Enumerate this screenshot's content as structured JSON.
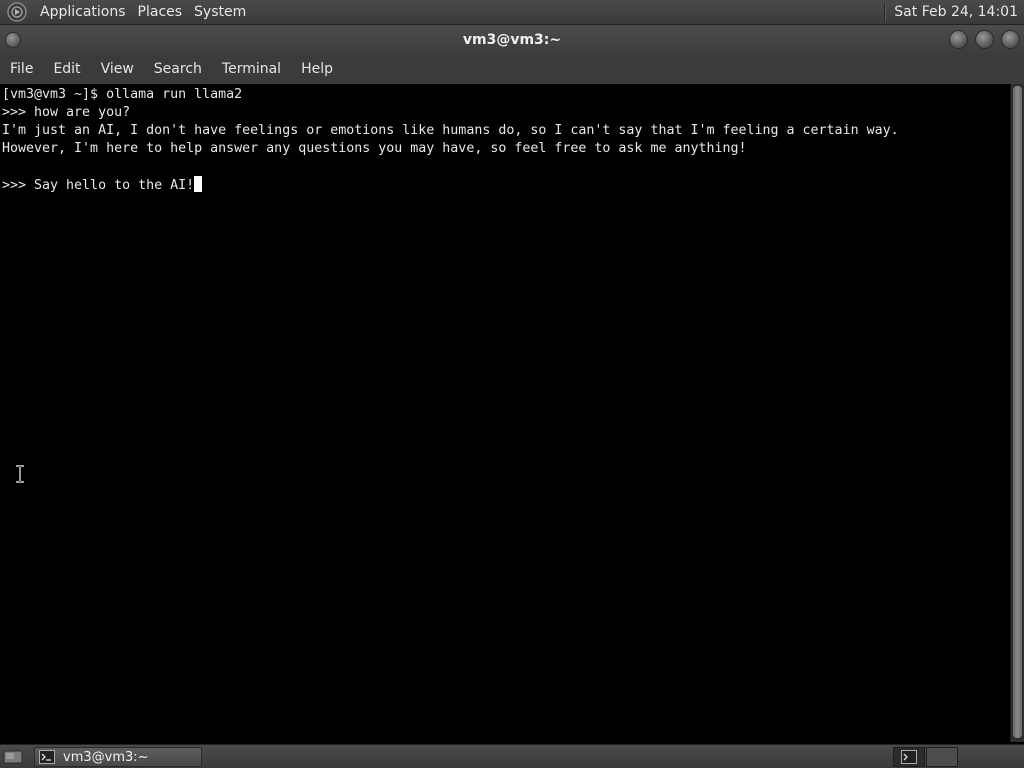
{
  "top_panel": {
    "menus": [
      "Applications",
      "Places",
      "System"
    ],
    "clock": "Sat Feb 24, 14:01"
  },
  "window": {
    "title": "vm3@vm3:~"
  },
  "menubar": {
    "items": [
      "File",
      "Edit",
      "View",
      "Search",
      "Terminal",
      "Help"
    ]
  },
  "terminal": {
    "lines": [
      "[vm3@vm3 ~]$ ollama run llama2",
      ">>> how are you?",
      "I'm just an AI, I don't have feelings or emotions like humans do, so I can't say that I'm feeling a certain way.",
      "However, I'm here to help answer any questions you may have, so feel free to ask me anything!",
      "",
      ">>> Say hello to the AI!"
    ]
  },
  "taskbar": {
    "task_label": "vm3@vm3:~"
  },
  "colors": {
    "panel": "#3b3b3b",
    "terminal_bg": "#000000",
    "terminal_fg": "#e8e8e8"
  }
}
